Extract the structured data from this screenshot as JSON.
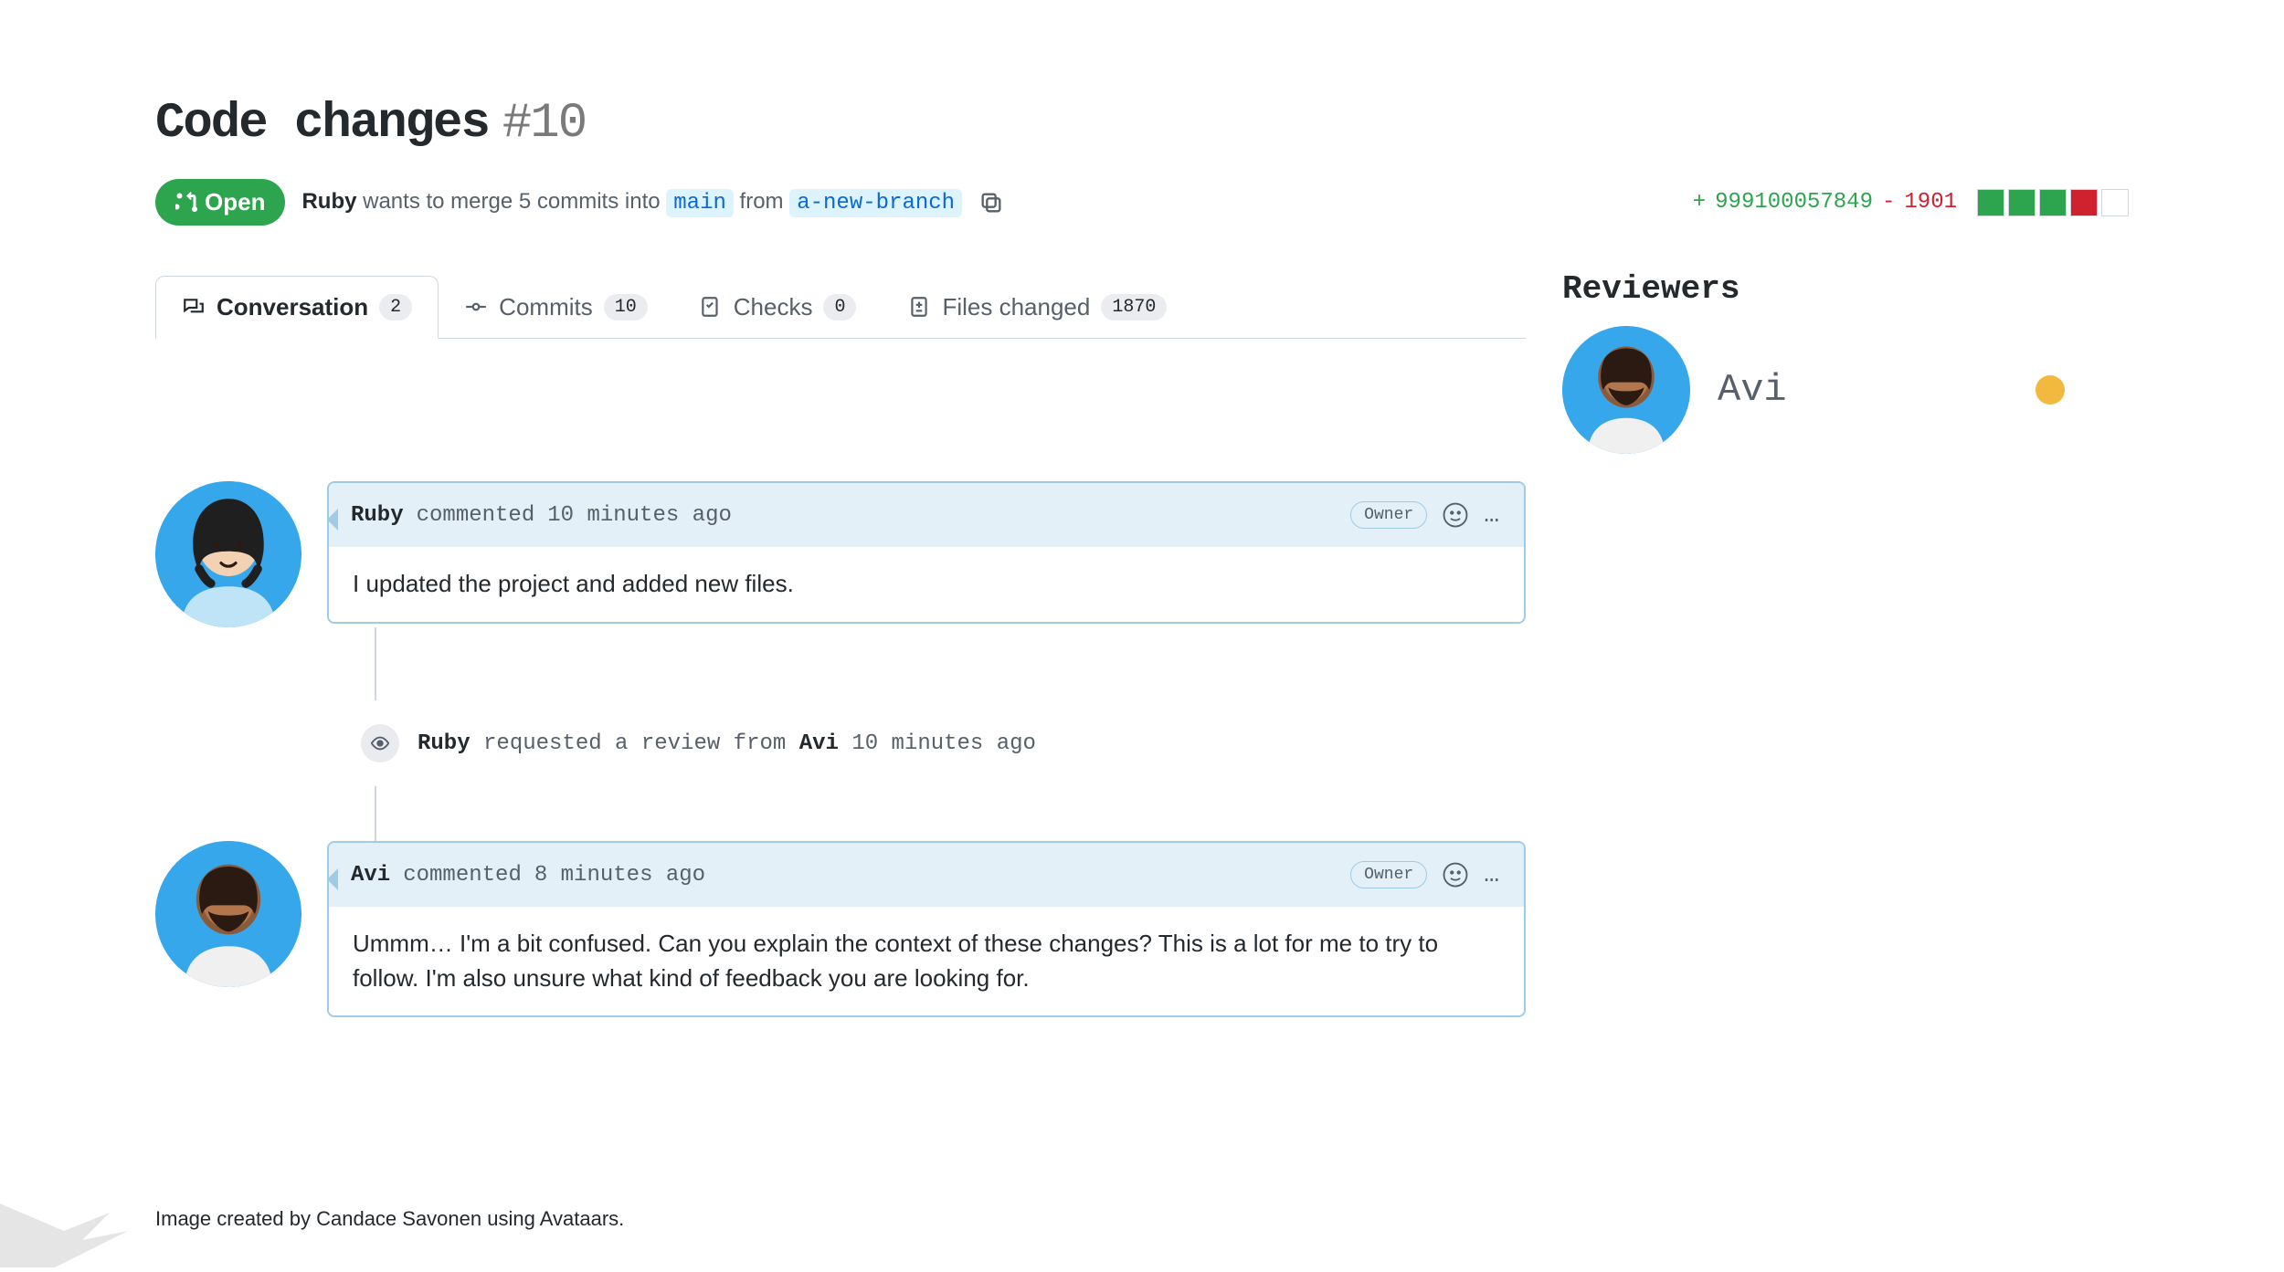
{
  "title": {
    "text": "Code changes",
    "number": "#10"
  },
  "status": {
    "pill_label": "Open",
    "author": "Ruby",
    "action_verb": "wants to merge",
    "commit_count": "5 commits into",
    "base_branch": "main",
    "from_word": "from",
    "head_branch": "a-new-branch"
  },
  "diffstat": {
    "plus": "+",
    "additions": "999100057849",
    "minus": "-",
    "deletions": "1901",
    "boxes": [
      "green",
      "green",
      "green",
      "red",
      "empty"
    ]
  },
  "tabs": [
    {
      "id": "conversation",
      "label": "Conversation",
      "count": "2",
      "selected": true
    },
    {
      "id": "commits",
      "label": "Commits",
      "count": "10"
    },
    {
      "id": "checks",
      "label": "Checks",
      "count": "0"
    },
    {
      "id": "files",
      "label": "Files changed",
      "count": "1870"
    }
  ],
  "reviewers": {
    "heading": "Reviewers",
    "list": [
      {
        "name": "Avi",
        "status": "pending"
      }
    ]
  },
  "timeline": {
    "comments": [
      {
        "author": "Ruby",
        "action": "commented",
        "time": "10 minutes ago",
        "badge": "Owner",
        "body": "I updated the project and added new files."
      },
      {
        "author": "Avi",
        "action": "commented",
        "time": "8 minutes ago",
        "badge": "Owner",
        "body": "Ummm… I'm a bit confused. Can you explain the context of these changes? This is a lot for me to try to follow.  I'm also unsure what kind of feedback you are looking for."
      }
    ],
    "event": {
      "actor": "Ruby",
      "action": "requested a review from",
      "target": "Avi",
      "time": "10 minutes ago"
    }
  },
  "credit": "Image created by Candace Savonen using Avataars."
}
